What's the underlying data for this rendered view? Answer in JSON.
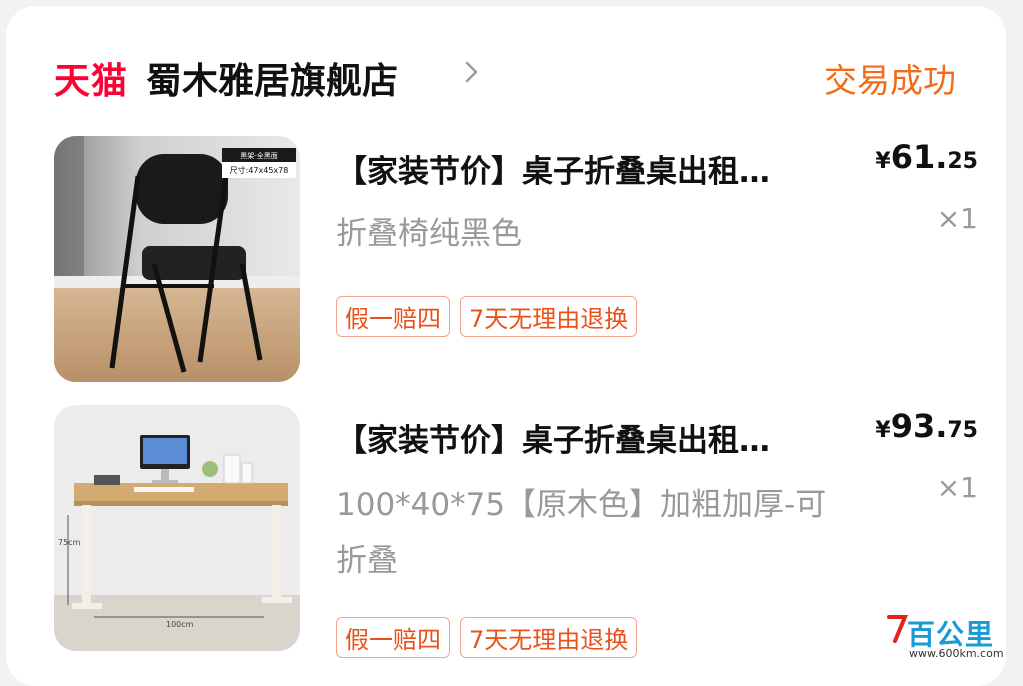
{
  "colors": {
    "tmall_red": "#ff0036",
    "status_orange": "#f36a18",
    "tag_text": "#e9531b",
    "tag_border": "#f0a58a",
    "muted_text": "#999999"
  },
  "header": {
    "platform_logo": "天猫",
    "shop_name": "蜀木雅居旗舰店",
    "order_status": "交易成功",
    "chevron_icon": "chevron-right-icon"
  },
  "items": [
    {
      "title": "【家装节价】桌子折叠桌出租…",
      "variant": "折叠椅纯黑色",
      "price_symbol": "¥",
      "price_int": "61.",
      "price_dec": "25",
      "quantity": "×1",
      "tags": [
        "假一赔四",
        "7天无理由退换"
      ],
      "image_caption_top": "黑架-全黑面",
      "image_caption_size": "尺寸:47x45x78"
    },
    {
      "title": "【家装节价】桌子折叠桌出租…",
      "variant": "100*40*75【原木色】加粗加厚-可折叠",
      "price_symbol": "¥",
      "price_int": "93.",
      "price_dec": "75",
      "quantity": "×1",
      "tags": [
        "假一赔四",
        "7天无理由退换"
      ],
      "image_dim_height": "75cm",
      "image_dim_width": "100cm"
    }
  ],
  "watermark": {
    "text": "百公里",
    "url": "www.600km.com"
  }
}
